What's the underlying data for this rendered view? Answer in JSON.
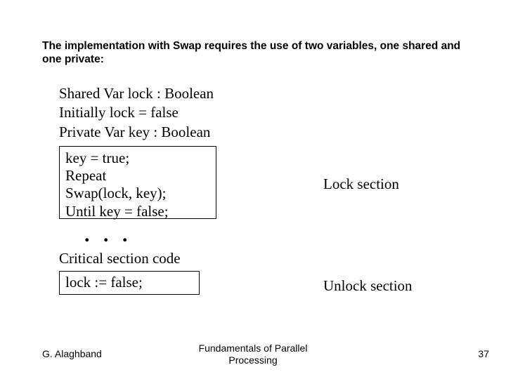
{
  "heading": "The implementation with Swap requires the use of two variables, one shared and one private:",
  "declarations": {
    "l1": "Shared Var  lock : Boolean",
    "l2": "Initially lock = false",
    "l3": "Private Var  key : Boolean"
  },
  "lock_block": {
    "l1": "key = true;",
    "l2": "Repeat",
    "l3": "Swap(lock, key);",
    "l4": "Until key = false;"
  },
  "dots": ". . .",
  "critical_label": "Critical section code",
  "unlock_block": {
    "l1": "lock := false;"
  },
  "side_labels": {
    "lock": "Lock section",
    "unlock": "Unlock section"
  },
  "footer": {
    "author": "G. Alaghband",
    "title_l1": "Fundamentals of Parallel",
    "title_l2": "Processing",
    "page": "37"
  }
}
